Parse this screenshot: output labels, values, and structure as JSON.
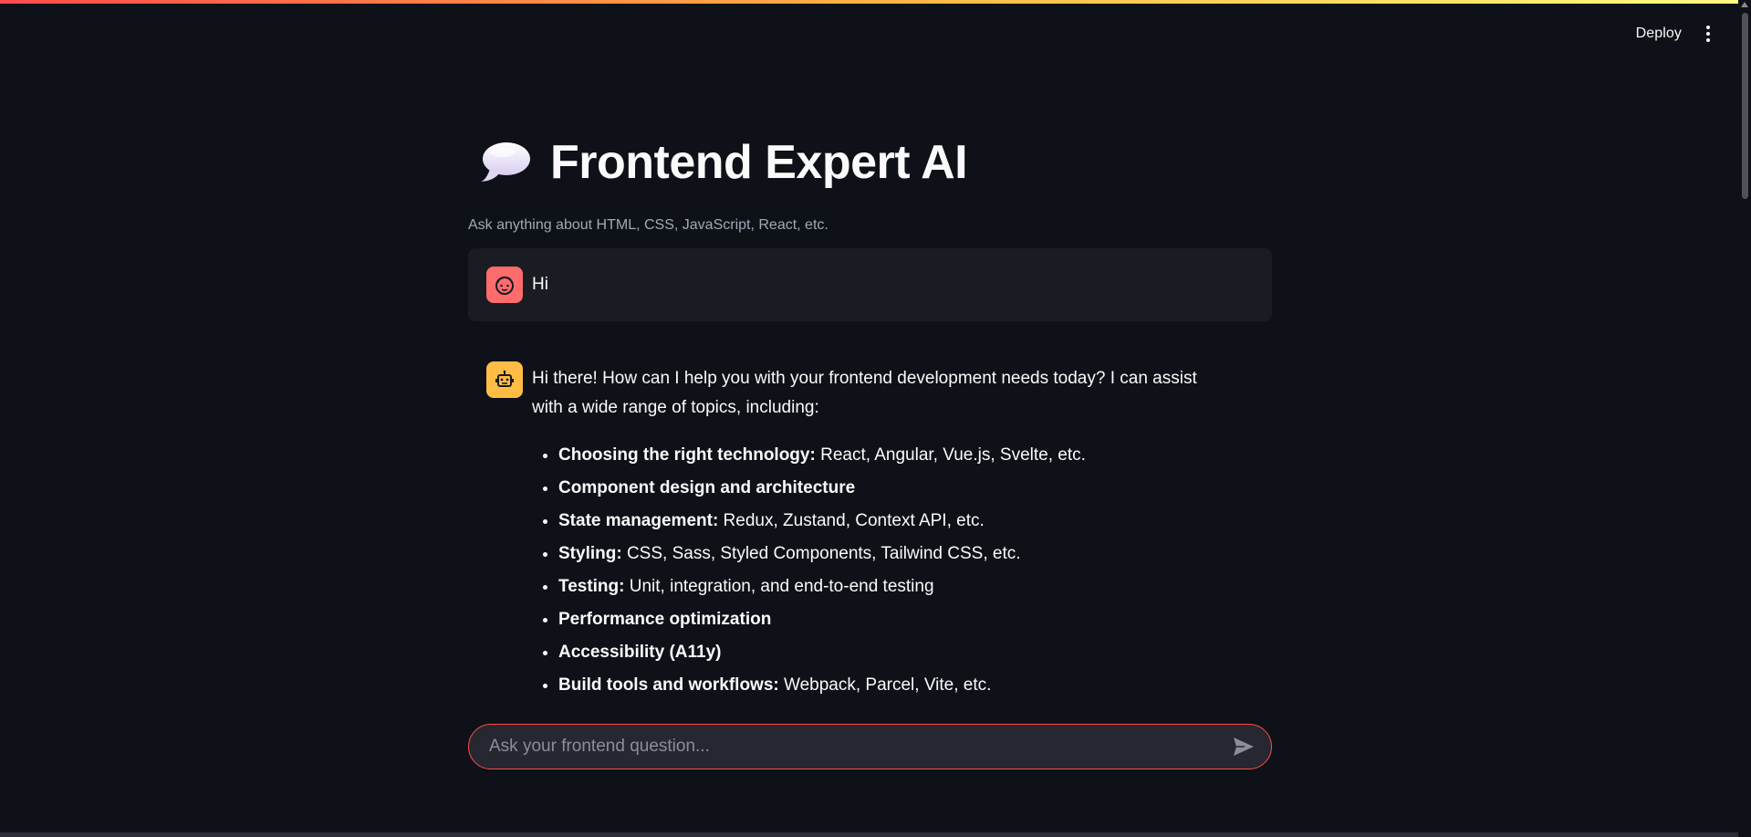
{
  "header": {
    "deploy_label": "Deploy",
    "menu_icon": "more-vertical-icon"
  },
  "page": {
    "title": "Frontend Expert AI",
    "title_icon": "speech-balloon-icon",
    "caption": "Ask anything about HTML, CSS, JavaScript, React, etc."
  },
  "messages": [
    {
      "role": "user",
      "avatar_icon": "user-face-icon",
      "text": "Hi"
    },
    {
      "role": "assistant",
      "avatar_icon": "robot-icon",
      "intro": "Hi there! How can I help you with your frontend development needs today? I can assist with a wide range of topics, including:",
      "topics": [
        {
          "term": "Choosing the right technology:",
          "detail": " React, Angular, Vue.js, Svelte, etc."
        },
        {
          "term": "Component design and architecture",
          "detail": ""
        },
        {
          "term": "State management:",
          "detail": " Redux, Zustand, Context API, etc."
        },
        {
          "term": "Styling:",
          "detail": " CSS, Sass, Styled Components, Tailwind CSS, etc."
        },
        {
          "term": "Testing:",
          "detail": " Unit, integration, and end-to-end testing"
        },
        {
          "term": "Performance optimization",
          "detail": ""
        },
        {
          "term": "Accessibility (A11y)",
          "detail": ""
        },
        {
          "term": "Build tools and workflows:",
          "detail": " Webpack, Parcel, Vite, etc."
        }
      ]
    }
  ],
  "chat_input": {
    "placeholder": "Ask your frontend question...",
    "value": "",
    "send_icon": "send-icon"
  },
  "colors": {
    "background": "#0e1117",
    "user_avatar": "#ff6c6c",
    "assistant_avatar": "#ffbd45",
    "input_border": "#ff4b4b"
  }
}
